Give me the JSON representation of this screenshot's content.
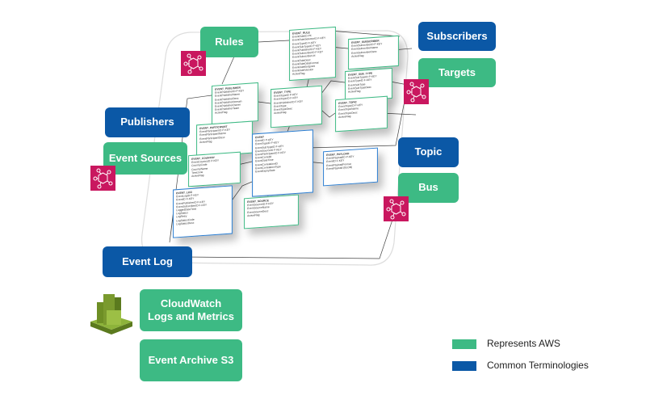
{
  "labels": {
    "rules": "Rules",
    "subscribers": "Subscribers",
    "targets": "Targets",
    "publishers": "Publishers",
    "event_sources": "Event Sources",
    "topic": "Topic",
    "bus": "Bus",
    "event_log": "Event Log",
    "cloudwatch_line1": "CloudWatch",
    "cloudwatch_line2": "Logs and Metrics",
    "event_archive": "Event Archive S3"
  },
  "legend": [
    {
      "label": "Represents AWS",
      "color": "#3dba84"
    },
    {
      "label": "Common Terminologies",
      "color": "#0b58a6"
    }
  ],
  "colors": {
    "aws": "#3dba84",
    "terminology": "#0b58a6",
    "eventbridge_icon": "#c9175f",
    "cloudwatch_icon": "#7a9a2e"
  },
  "icons": [
    "eventbridge-icon",
    "cloudwatch-icon"
  ],
  "tables": [
    {
      "name": "EVENT_RULE",
      "color": "green",
      "fields": [
        "EventRuleID PK",
        "EventRuleSelectorID F-KEY",
        "EventTypeID F-KEY",
        "EventSubTypeID F-KEY",
        "EventPublisherID F-KEY",
        "EventSubscriberID F-KEY",
        "EventSubscriberUrl",
        "EventRuleDesc",
        "EventRuleDataFormat",
        "EventRuleEndpoint",
        "EventRuleVersion",
        "ActiveFlag"
      ]
    },
    {
      "name": "EVENT_SUBSCRIBER",
      "color": "green",
      "fields": [
        "EventSubscriberID P-KEY",
        "EventSubscriberName",
        "EventSubscriberDesc",
        "ActiveFlag"
      ]
    },
    {
      "name": "EVENT_PUBLISHER",
      "color": "green",
      "fields": [
        "EventPublisherID P-KEY",
        "EventPublisherName",
        "EventPublisherDesc",
        "EventPublisherDomain",
        "EventPublisherOwner",
        "EventPublisherTeam",
        "ActiveFlag"
      ]
    },
    {
      "name": "EVENT_TYPE",
      "color": "green",
      "fields": [
        "EventTypeID P-KEY",
        "EventTopicID F-KEY",
        "EventPublisherID F-KEY",
        "EventType",
        "EventTypeDesc",
        "ActiveFlag"
      ]
    },
    {
      "name": "EVENT_SUB_TYPE",
      "color": "green",
      "fields": [
        "EventSubTypeID P-KEY",
        "EventTypeID F-KEY",
        "EventSubType",
        "EventSubTypeDesc",
        "ActiveFlag"
      ]
    },
    {
      "name": "EVENT_TOPIC",
      "color": "green",
      "fields": [
        "EventTopicID P-KEY",
        "EventTopicName",
        "EventTopicDesc",
        "ActiveFlag"
      ]
    },
    {
      "name": "EVENT_PARTICIPANT",
      "color": "green",
      "fields": [
        "EventParticipantID P-KEY",
        "EventParticipantName",
        "EventParticipantDesc",
        "ActiveFlag"
      ]
    },
    {
      "name": "EVENT",
      "color": "blue",
      "fields": [
        "EventID P-KEY",
        "EventTypeID F-KEY",
        "EventSubTypeID F-KEY",
        "EventSourceID F-KEY",
        "EventParticipantID F-KEY",
        "EventCorrelId",
        "EventDateTime",
        "EventCorrelationID",
        "EventCorrelationType",
        "EventExpiryDate"
      ]
    },
    {
      "name": "EVENT_PAYLOAD",
      "color": "blue",
      "fields": [
        "EventPayloadID P-KEY",
        "EventID F-KEY",
        "EventPayloadFormat",
        "EventPayload (BLOB)"
      ]
    },
    {
      "name": "EVENT_COUNTRY",
      "color": "green",
      "fields": [
        "EventCountryID P-KEY",
        "CountryCode",
        "CountryName",
        "Timezone",
        "ActiveFlag"
      ]
    },
    {
      "name": "EVENT_LOG",
      "color": "blue",
      "fields": [
        "EventLogID P-KEY",
        "EventID F-KEY",
        "EventPublisherID F-KEY",
        "EventSubscriberID F-KEY",
        "LoggedDateTime",
        "LogStatus",
        "LogRetry",
        "LogStatusCode",
        "LogStatusDesc"
      ]
    },
    {
      "name": "EVENT_SOURCE",
      "color": "green",
      "fields": [
        "EventSourceID P-KEY",
        "EventSourceName",
        "EventSourceDesc",
        "ActiveFlag"
      ]
    }
  ]
}
